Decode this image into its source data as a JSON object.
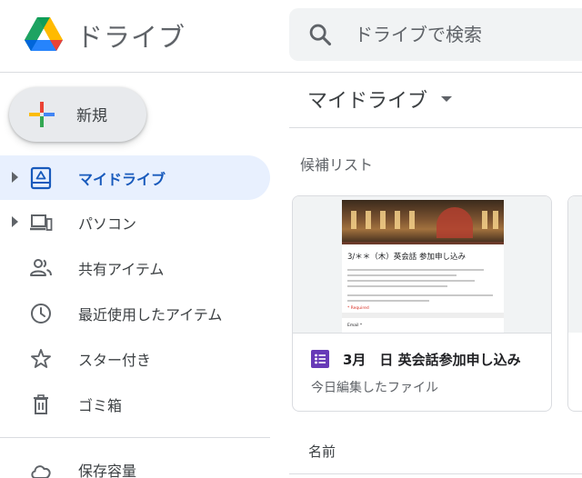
{
  "header": {
    "app_title": "ドライブ",
    "search_placeholder": "ドライブで検索",
    "logo_icon": "google-drive-logo",
    "search_icon": "search-icon"
  },
  "new_button": {
    "label": "新規",
    "icon": "plus-icon"
  },
  "sidebar": {
    "items": [
      {
        "label": "マイドライブ",
        "icon": "my-drive-icon",
        "active": true,
        "expandable": true
      },
      {
        "label": "パソコン",
        "icon": "computer-icon",
        "active": false,
        "expandable": true
      },
      {
        "label": "共有アイテム",
        "icon": "shared-icon",
        "active": false,
        "expandable": false
      },
      {
        "label": "最近使用したアイテム",
        "icon": "clock-icon",
        "active": false,
        "expandable": false
      },
      {
        "label": "スター付き",
        "icon": "star-icon",
        "active": false,
        "expandable": false
      },
      {
        "label": "ゴミ箱",
        "icon": "trash-icon",
        "active": false,
        "expandable": false
      }
    ],
    "storage_label": "保存容量"
  },
  "main": {
    "title": "マイドライブ",
    "suggested_label": "候補リスト",
    "card": {
      "name": "3月　日 英会話参加申し込み",
      "meta": "今日編集したファイル",
      "icon": "google-forms-icon",
      "preview_title": "3/＊＊（木）英会話 参加申し込み",
      "preview_required": "* Required",
      "preview_field": "Email *"
    },
    "list_header": "名前"
  },
  "colors": {
    "active_bg": "#e8f0fe",
    "active_text": "#185abc",
    "forms_purple": "#673ab7",
    "search_bg": "#f1f3f4"
  }
}
